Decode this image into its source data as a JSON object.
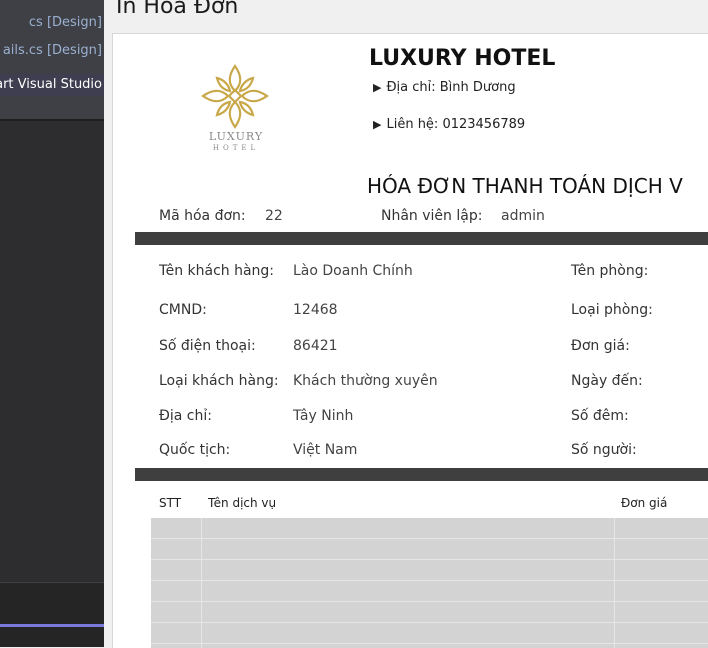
{
  "vs_tabs": [
    {
      "label": "cs [Design]"
    },
    {
      "label": "ails.cs [Design]"
    },
    {
      "label": "art Visual Studio"
    }
  ],
  "window": {
    "title": "In Hoá Đơn"
  },
  "hotel": {
    "logo_line1": "LUXURY",
    "logo_line2": "HOTEL",
    "name": "LUXURY HOTEL",
    "address": "Địa chỉ: Bình Dương",
    "contact": "Liên hệ: 0123456789"
  },
  "invoice": {
    "title": "HÓA ĐƠN THANH TOÁN DỊCH V",
    "id_label": "Mã hóa đơn:",
    "id_value": "22",
    "staff_label": "Nhân viên lập:",
    "staff_value": "admin"
  },
  "customer": [
    {
      "label": "Tên khách hàng:",
      "value": "Lào Doanh Chính"
    },
    {
      "label": "CMND:",
      "value": "12468"
    },
    {
      "label": "Số điện thoại:",
      "value": "86421"
    },
    {
      "label": "Loại khách hàng:",
      "value": "Khách thường xuyên"
    },
    {
      "label": "Địa chỉ:",
      "value": "Tây Ninh"
    },
    {
      "label": "Quốc tịch:",
      "value": "Việt Nam"
    }
  ],
  "room": [
    {
      "label": "Tên phòng:"
    },
    {
      "label": "Loại phòng:"
    },
    {
      "label": "Đơn giá:"
    },
    {
      "label": "Ngày đến:"
    },
    {
      "label": "Số đêm:"
    },
    {
      "label": "Số người:"
    }
  ],
  "services_table": {
    "headers": [
      "STT",
      "Tên dịch vụ",
      "Đơn giá"
    ]
  },
  "colors": {
    "logo_gold": "#c9a84a",
    "bar": "#3f3f3f",
    "table_row": "#d3d3d3"
  }
}
